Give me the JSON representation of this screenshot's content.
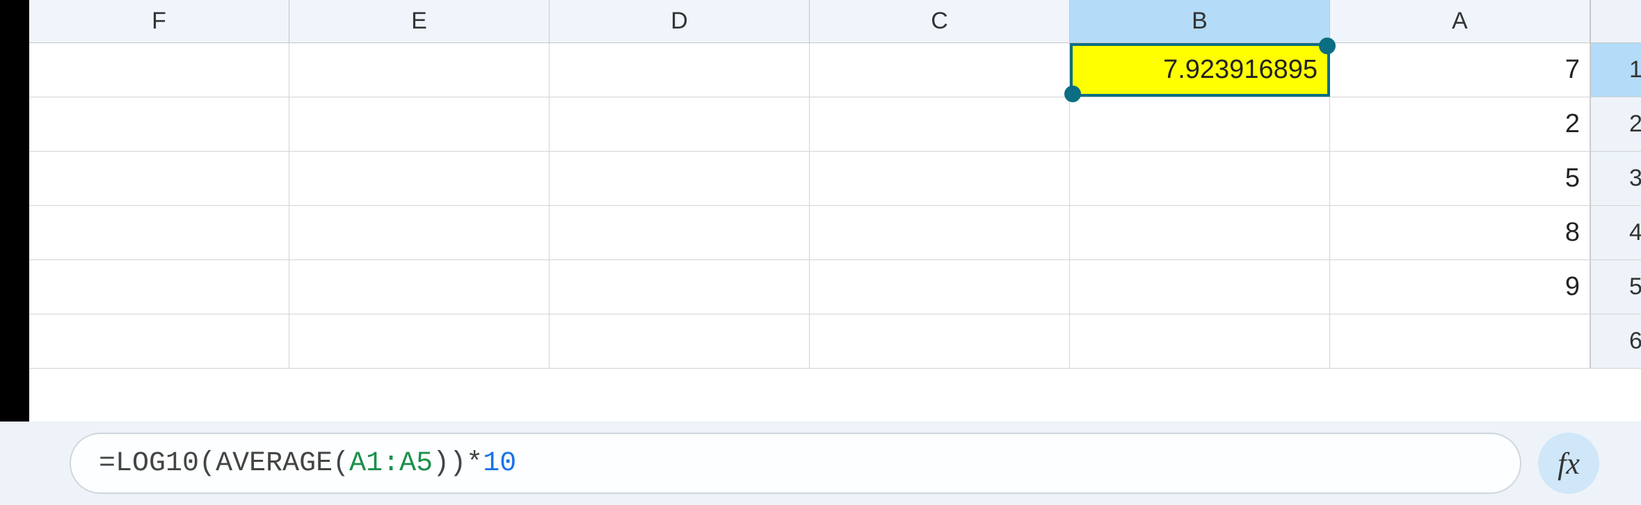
{
  "columns": [
    "F",
    "E",
    "D",
    "C",
    "B",
    "A"
  ],
  "selected_column": "B",
  "rows": [
    1,
    2,
    3,
    4,
    5,
    6
  ],
  "selected_row": 1,
  "cells": {
    "A1": "7",
    "A2": "2",
    "A3": "5",
    "A4": "8",
    "A5": "9",
    "B1": "7.923916895"
  },
  "selected_cell": "B1",
  "formula": {
    "prefix": "=",
    "fn1": "LOG10",
    "open1": "(",
    "fn2": "AVERAGE",
    "open2": "(",
    "range": "A1:A5",
    "close2": ")",
    "close1": ")",
    "op": "*",
    "num": "10"
  },
  "fx_label": "fx"
}
